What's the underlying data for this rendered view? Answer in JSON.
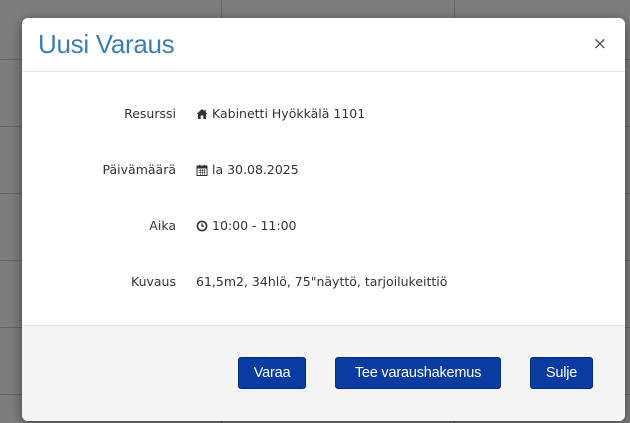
{
  "modal": {
    "title": "Uusi Varaus",
    "close_glyph": "×"
  },
  "details": [
    {
      "label": "Resurssi",
      "icon": "home-icon",
      "value": "Kabinetti Hyökkälä 1101"
    },
    {
      "label": "Päivämäärä",
      "icon": "calendar-icon",
      "value": "la 30.08.2025"
    },
    {
      "label": "Aika",
      "icon": "clock-icon",
      "value": "10:00 - 11:00"
    },
    {
      "label": "Kuvaus",
      "icon": "",
      "value": "61,5m2, 34hlö, 75\"näyttö, tarjoilukeittiö"
    }
  ],
  "buttons": {
    "reserve": "Varaa",
    "application": "Tee varaushakemus",
    "close": "Sulje"
  },
  "colors": {
    "title": "#3d7fb5",
    "button": "#0a3ba1",
    "overlay": "#7d7d7d"
  }
}
